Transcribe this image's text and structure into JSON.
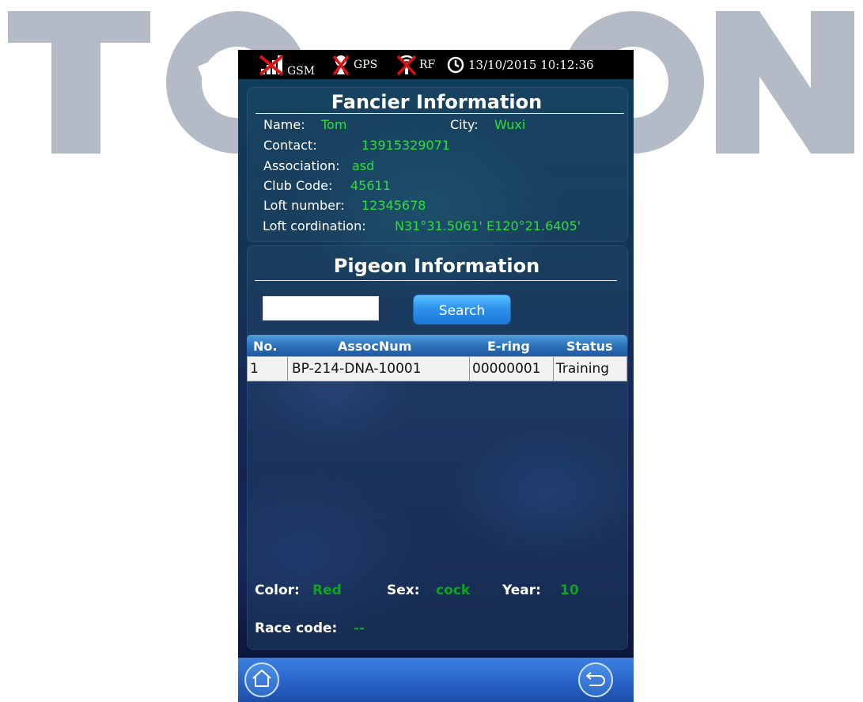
{
  "watermark": {
    "text": "TOPICOM"
  },
  "status_bar": {
    "gsm_label": "GSM",
    "gps_label": "GPS",
    "rf_label": "RF",
    "datetime": "13/10/2015 10:12:36",
    "icons": [
      "signal-off-icon",
      "gps-off-icon",
      "rf-off-icon",
      "clock-icon"
    ]
  },
  "fancier": {
    "title": "Fancier Information",
    "name_label": "Name:",
    "name_value": "Tom",
    "city_label": "City:",
    "city_value": "Wuxi",
    "contact_label": "Contact:",
    "contact_value": "13915329071",
    "association_label": "Association:",
    "association_value": "asd",
    "club_code_label": "Club Code:",
    "club_code_value": "45611",
    "loft_number_label": "Loft number:",
    "loft_number_value": "12345678",
    "loft_coord_label": "Loft cordination:",
    "loft_coord_value": "N31°31.5061' E120°21.6405'"
  },
  "pigeon": {
    "title": "Pigeon Information",
    "search_value": "",
    "search_button": "Search",
    "table": {
      "headers": [
        "No.",
        "AssocNum",
        "E-ring",
        "Status"
      ],
      "rows": [
        [
          "1",
          "BP-214-DNA-10001",
          "00000001",
          "Training"
        ]
      ]
    },
    "color_label": "Color:",
    "color_value": "Red",
    "sex_label": "Sex:",
    "sex_value": "cock",
    "year_label": "Year:",
    "year_value": "10",
    "race_code_label": "Race code:",
    "race_code_value": "--"
  },
  "nav": {
    "home_icon": "home-icon",
    "back_icon": "back-icon"
  },
  "colors": {
    "value_text": "#32dc3c",
    "detail_value_text": "#0ca51e",
    "table_header": "#2b6fb8",
    "search_button": "#2d93ec",
    "bottom_bar": "#2a66cc",
    "watermark": "#b4bac6"
  }
}
